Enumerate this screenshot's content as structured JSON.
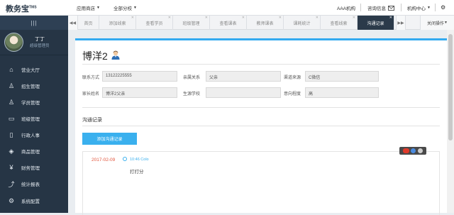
{
  "header": {
    "logo": "教务宝",
    "logo_sup": "TMS",
    "menu_app": "应用商店",
    "menu_school": "全部分校",
    "org": "AAA机构",
    "messages": "咨询信息",
    "org_center": "机构中心"
  },
  "sidebar": {
    "profile_name": "丁丁",
    "profile_role": "超级管理员",
    "items": [
      {
        "label": "营业大厅",
        "icon": "home-icon"
      },
      {
        "label": "招生管理",
        "icon": "user-plus-icon"
      },
      {
        "label": "学员管理",
        "icon": "user-icon"
      },
      {
        "label": "班级管理",
        "icon": "class-icon"
      },
      {
        "label": "行政人事",
        "icon": "doc-icon"
      },
      {
        "label": "商品管理",
        "icon": "tag-icon"
      },
      {
        "label": "财务管理",
        "icon": "yen-icon"
      },
      {
        "label": "统计报表",
        "icon": "chart-icon"
      },
      {
        "label": "系统配置",
        "icon": "gear-icon"
      }
    ]
  },
  "tabs": {
    "items": [
      "首页",
      "添加线索",
      "查看学员",
      "班级管理",
      "查看课表",
      "教师课表",
      "课耗统计",
      "查看线索",
      "沟通记录"
    ],
    "active_index": 8,
    "ops": "关闭操作"
  },
  "person": {
    "name": "博洋2",
    "fields": {
      "contact_label": "联系方式",
      "contact_value": "13122225555",
      "relation_label": "亲属关系",
      "relation_value": "父亲",
      "channel_label": "渠道来源",
      "channel_value": "C微信",
      "parent_label": "家长姓名",
      "parent_value": "博洋2父亲",
      "school_label": "生源学校",
      "school_value": "",
      "intent_label": "意向程度",
      "intent_value": "高"
    }
  },
  "comm": {
    "title": "沟通记录",
    "add_button": "添加沟通记录",
    "records": [
      {
        "date": "2017-02-09",
        "time": "10:46 Colo",
        "text": "打打分"
      }
    ]
  },
  "colors": {
    "accent": "#33aaf0",
    "sidebar": "#263545",
    "date": "#e2553c"
  }
}
